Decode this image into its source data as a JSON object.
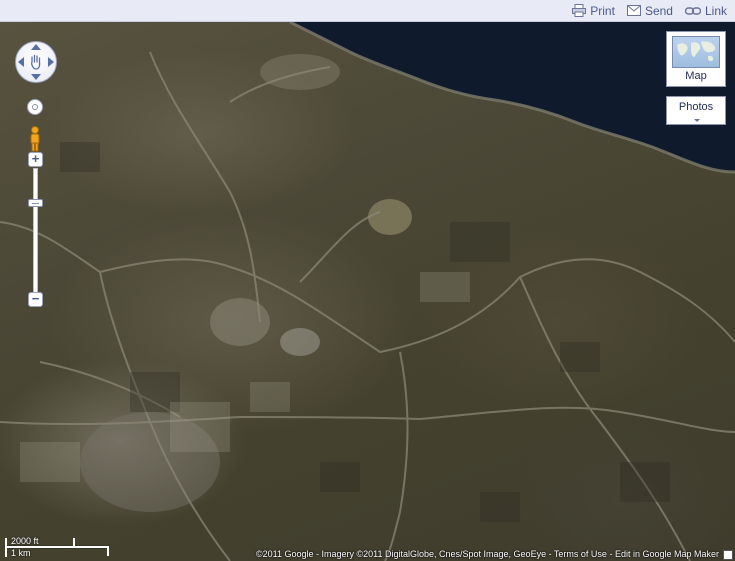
{
  "toolbar": {
    "print_label": "Print",
    "send_label": "Send",
    "link_label": "Link",
    "print_icon": "printer-icon",
    "send_icon": "envelope-icon",
    "link_icon": "chain-link-icon"
  },
  "map": {
    "view": "satellite",
    "map_type_label": "Map",
    "photos_label": "Photos",
    "scale": {
      "imperial": "2000 ft",
      "metric": "1 km"
    },
    "copyright": {
      "prefix": "©2011 Google - Imagery ©2011 DigitalGlobe, Cnes/Spot Image, GeoEye - ",
      "terms_label": "Terms of Use",
      "separator": " - ",
      "edit_label": "Edit in Google Map Maker"
    },
    "colors": {
      "toolbar_bg": "#e8ebf6",
      "control_accent": "#5a6ea8",
      "sea": "#0f1a2c"
    }
  }
}
